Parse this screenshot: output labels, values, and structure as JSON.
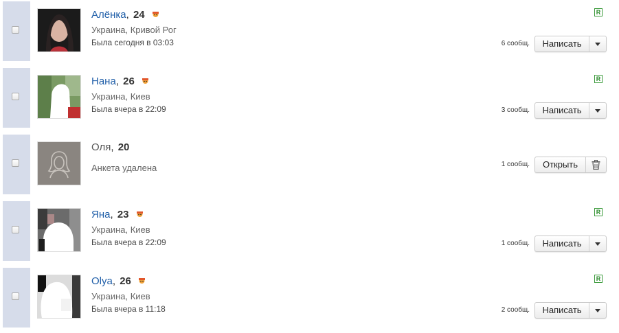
{
  "rows": [
    {
      "name": "Алёнка",
      "age": "24",
      "location": "Украина, Кривой Рог",
      "last_seen": "Была сегодня в 03:03",
      "messages": "6 сообщ.",
      "button": "Написать",
      "badge": "R",
      "avatar": "photo-portrait-icon"
    },
    {
      "name": "Нана",
      "age": "26",
      "location": "Украина, Киев",
      "last_seen": "Была вчера в 22:09",
      "messages": "3 сообщ.",
      "button": "Написать",
      "badge": "R",
      "avatar": "photo-redacted-icon"
    },
    {
      "name": "Оля",
      "age": "20",
      "status": "Анкета удалена",
      "messages": "1 сообщ.",
      "button": "Открыть",
      "avatar": "placeholder-woman-icon"
    },
    {
      "name": "Яна",
      "age": "23",
      "location": "Украина, Киев",
      "last_seen": "Была вчера в 22:09",
      "messages": "1 сообщ.",
      "button": "Написать",
      "badge": "R",
      "avatar": "photo-redacted-icon"
    },
    {
      "name": "Olya",
      "age": "26",
      "location": "Украина, Киев",
      "last_seen": "Была вчера в 11:18",
      "messages": "2 сообщ.",
      "button": "Написать",
      "badge": "R",
      "avatar": "photo-redacted-icon"
    }
  ],
  "colors": {
    "link": "#1f5ea8",
    "strip": "#d6dcea",
    "badge": "#2a8a2a"
  }
}
